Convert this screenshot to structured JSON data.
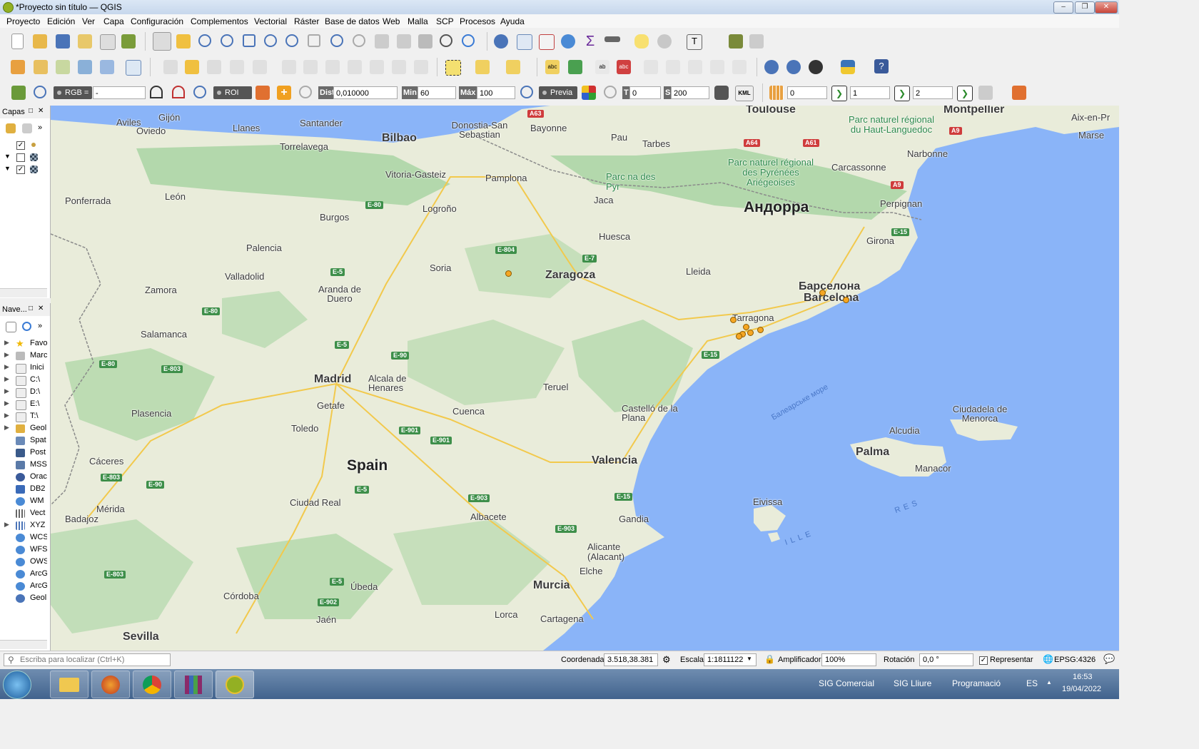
{
  "window": {
    "title": "*Proyecto sin título — QGIS"
  },
  "menu": [
    "Proyecto",
    "Edición",
    "Ver",
    "Capa",
    "Configuración",
    "Complementos",
    "Vectorial",
    "Ráster",
    "Base de datos",
    "Web",
    "Malla",
    "SCP",
    "Procesos",
    "Ayuda"
  ],
  "scp_toolbar": {
    "rgb_label": "RGB =",
    "rgb_value": "-",
    "roi_label": "ROI",
    "dist_label": "Dist",
    "dist_value": "0,010000",
    "min_label": "Min",
    "min_value": "60",
    "max_label": "Máx",
    "max_value": "100",
    "preview_label": "Previa",
    "t_label": "T",
    "t_value": "0",
    "s_label": "S",
    "s_value": "200",
    "kml_label": "KML",
    "band1": "0",
    "band2": "1",
    "band3": "2"
  },
  "layers_panel": {
    "title": "Capas"
  },
  "browser_panel": {
    "title": "Nave...",
    "items": [
      "Favo",
      "Marc",
      "Inici",
      "C:\\",
      "D:\\",
      "E:\\",
      "T:\\",
      "Geol",
      "Spat",
      "Post",
      "MSS",
      "Orac",
      "DB2",
      "WM",
      "Vect",
      "XYZ",
      "WCS",
      "WFS",
      "OWS",
      "ArcG",
      "ArcG",
      "Geol"
    ]
  },
  "map": {
    "labels": [
      "Toulouse",
      "Montpellier",
      "Aix-en-Pr",
      "Marse",
      "Gijón",
      "Aviles",
      "Oviedo",
      "Llanes",
      "Santander",
      "Torrelavega",
      "Bilbao",
      "Donostia-San Sebastian",
      "Bayonne",
      "Pau",
      "Tarbes",
      "Vitoria-Gasteiz",
      "Pamplona",
      "Narbonne",
      "Carcassonne",
      "León",
      "Ponferrada",
      "Logroño",
      "Burgos",
      "Jaca",
      "Андорра",
      "Perpignan",
      "Huesca",
      "Palencia",
      "Girona",
      "Valladolid",
      "Soria",
      "Zaragoza",
      "Lleida",
      "Zamora",
      "Aranda de Duero",
      "Барселона",
      "Barcelona",
      "Tarragona",
      "Salamanca",
      "Madrid",
      "Alcala de Henares",
      "Getafe",
      "Teruel",
      "Plasencia",
      "Toledo",
      "Cuenca",
      "Castelló de la Plana",
      "Ciudadela de Menorca",
      "Alcudia",
      "Palma",
      "Manacor",
      "Cáceres",
      "Spain",
      "Valencia",
      "Mérida",
      "Badajoz",
      "Ciudad Real",
      "Albacete",
      "Gandia",
      "Eivissa",
      "Alicante (Alacant)",
      "Elche",
      "Murcia",
      "Córdoba",
      "Úbeda",
      "Jaén",
      "Lorca",
      "Cartagena",
      "Sevilla",
      "Parc naturel régional du Haut-Languedoc",
      "Parc naturel régional des Pyrénées Ariégeoises",
      "Parc na des Pyr",
      "Балеарське море",
      "ILLE",
      "RES"
    ]
  },
  "status": {
    "search_placeholder": "Escriba para localizar (Ctrl+K)",
    "coord_label": "Coordenada",
    "coord_value": "3.518,38.381",
    "scale_label": "Escala",
    "scale_value": "1:1811122",
    "magnifier_label": "Amplificador",
    "magnifier_value": "100%",
    "rotation_label": "Rotación",
    "rotation_value": "0,0 °",
    "render_label": "Representar",
    "crs": "EPSG:4326"
  },
  "taskbar": {
    "groups": [
      "SIG Comercial",
      "SIG Lliure",
      "Programació"
    ],
    "lang": "ES",
    "time": "16:53",
    "date": "19/04/2022"
  },
  "colors": {
    "water": "#8ab4f8",
    "land": "#e9ecda",
    "forest": "#a9d5a3",
    "point": "#f5a623"
  }
}
